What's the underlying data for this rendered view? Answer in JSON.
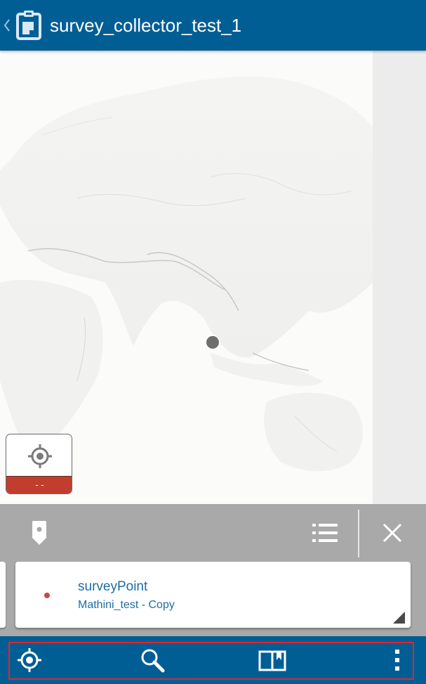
{
  "header": {
    "title": "survey_collector_test_1",
    "back_icon": "chevron-left-icon",
    "app_icon": "clipboard-icon",
    "background_color": "#005e95"
  },
  "map": {
    "gps": {
      "icon": "gps-target-icon",
      "accuracy_text": "- -",
      "accuracy_color": "#c13d2d"
    },
    "location_marker_icon": "location-dot-icon"
  },
  "panel": {
    "pin_icon": "map-pin-icon",
    "list_icon": "list-icon",
    "close_icon": "close-icon",
    "feature": {
      "name": "surveyPoint",
      "layer": "Mathini_test - Copy",
      "symbol_color": "#c74a43"
    }
  },
  "bottom_bar": {
    "items": [
      {
        "name": "locate",
        "icon": "crosshair-icon"
      },
      {
        "name": "search",
        "icon": "search-icon"
      },
      {
        "name": "bookmarks",
        "icon": "book-icon"
      },
      {
        "name": "more",
        "icon": "more-vertical-icon"
      }
    ]
  }
}
